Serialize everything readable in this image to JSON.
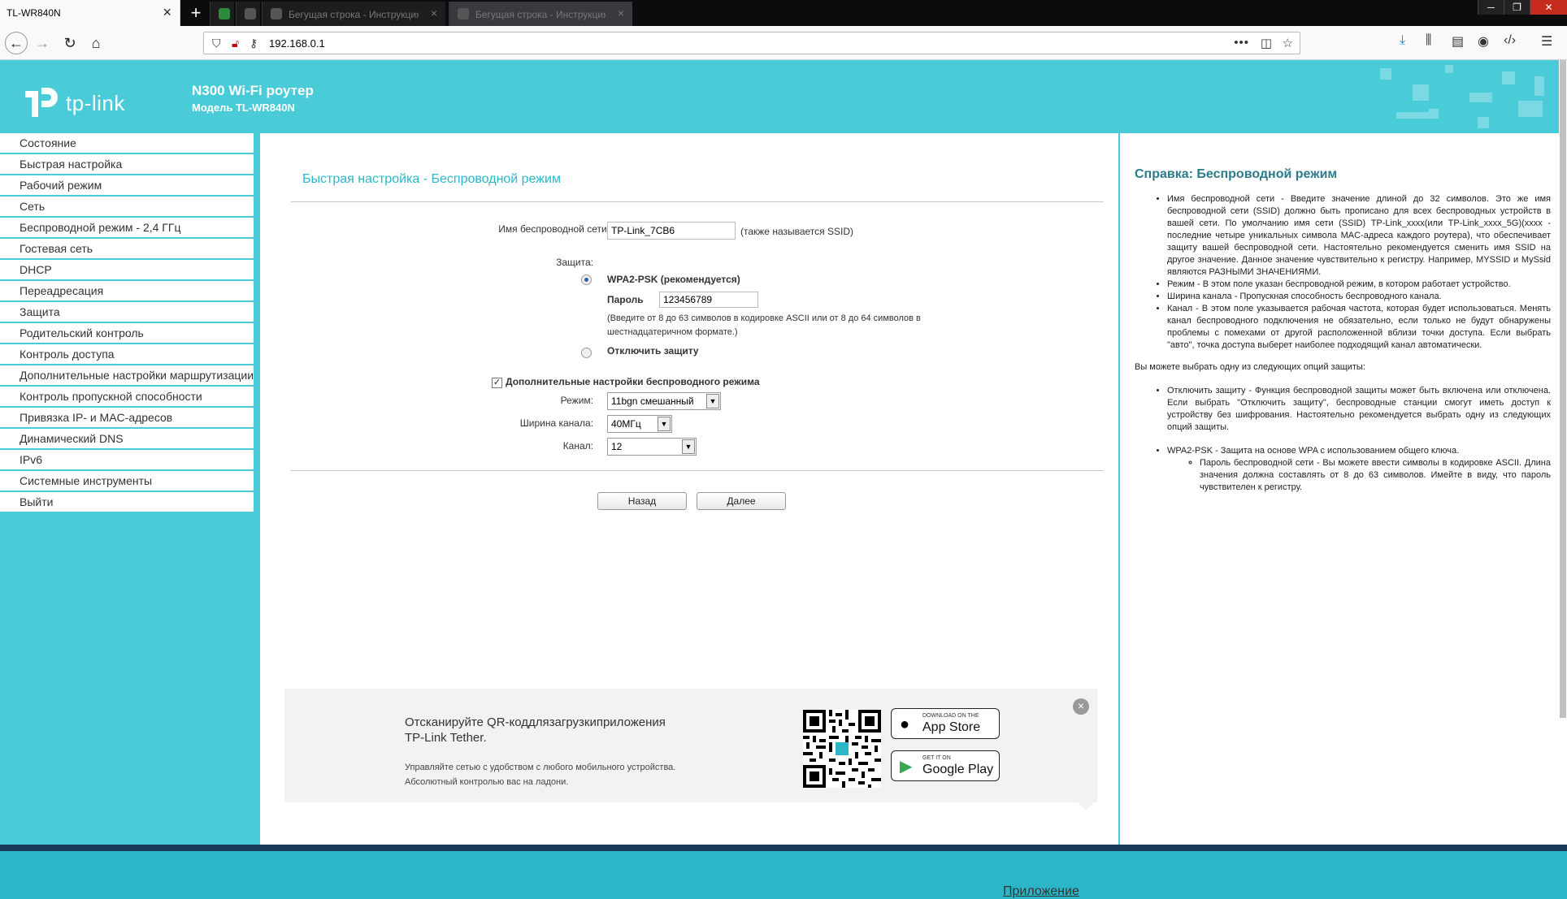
{
  "browser": {
    "active_tab_title": "TL-WR840N",
    "bg_tabs": [
      "Бегущая строка - Инструкция",
      "Бегущая строка - Инструкция"
    ],
    "url": "192.168.0.1"
  },
  "header": {
    "logo_text": "tp-link",
    "product_title": "N300 Wi-Fi роутер",
    "product_model": "Модель TL-WR840N"
  },
  "sidebar": {
    "items": [
      {
        "label": "Состояние"
      },
      {
        "label": "Быстрая настройка"
      },
      {
        "label": "Рабочий режим"
      },
      {
        "label": "Сеть"
      },
      {
        "label": "Беспроводной режим - 2,4 ГГц"
      },
      {
        "label": "Гостевая сеть"
      },
      {
        "label": "DHCP"
      },
      {
        "label": "Переадресация"
      },
      {
        "label": "Защита"
      },
      {
        "label": "Родительский контроль"
      },
      {
        "label": "Контроль доступа"
      },
      {
        "label": "Дополнительные настройки маршрутизации"
      },
      {
        "label": "Контроль пропускной способности"
      },
      {
        "label": "Привязка IP- и MAC-адресов"
      },
      {
        "label": "Динамический DNS"
      },
      {
        "label": "IPv6"
      },
      {
        "label": "Системные инструменты"
      },
      {
        "label": "Выйти"
      }
    ]
  },
  "form": {
    "page_title": "Быстрая настройка - Беспроводной режим",
    "ssid_label": "Имя беспроводной сети:",
    "ssid_value": "TP-Link_7CB6",
    "ssid_note": "(также называется SSID)",
    "security_label": "Защита:",
    "wpa2_label": "WPA2-PSK (рекомендуется)",
    "password_label": "Пароль",
    "password_value": "123456789",
    "password_hint_1": "(Введите от 8 до 63 символов в кодировке ASCII или от 8 до 64 символов в",
    "password_hint_2": "шестнадцатеричном формате.)",
    "disable_label": "Отключить защиту",
    "advanced_label": "Дополнительные настройки беспроводного режима",
    "mode_label": "Режим:",
    "mode_value": "11bgn смешанный",
    "width_label": "Ширина канала:",
    "width_value": "40МГц",
    "channel_label": "Канал:",
    "channel_value": "12",
    "back_button": "Назад",
    "next_button": "Далее"
  },
  "app_banner": {
    "title": "Отсканируйте QR-коддлязагрузкиприложения TP-Link Tether.",
    "desc_1": "Управляйте сетью с удобством с любого мобильного устройства.",
    "desc_2": "Абсолютный контролью вас на ладони.",
    "appstore_small": "DOWNLOAD ON THE",
    "appstore_big": "App Store",
    "gplay_small": "GET IT ON",
    "gplay_big": "Google Play",
    "link": "Приложение"
  },
  "help": {
    "title": "Справка: Беспроводной режим",
    "items_1": [
      "Имя беспроводной сети - Введите значение длиной до 32 символов. Это же имя беспроводной сети (SSID) должно быть прописано для всех беспроводных устройств в вашей сети. По умолчанию имя сети (SSID) TP-Link_xxxx(или TP-Link_xxxx_5G)(xxxx - последние четыре уникальных символа MAC-адреса каждого роутера), что обеспечивает защиту вашей беспроводной сети. Настоятельно рекомендуется сменить имя SSID на другое значение. Данное значение чувствительно к регистру. Например, MYSSID и MySsid являются РАЗНЫМИ ЗНАЧЕНИЯМИ.",
      "Режим - В этом поле указан беспроводной режим, в котором работает устройство.",
      "Ширина канала - Пропускная способность беспроводного канала.",
      "Канал - В этом поле указывается рабочая частота, которая будет использоваться. Менять канал беспроводного подключения не обязательно, если только не будут обнаружены проблемы с помехами от другой расположенной вблизи точки доступа. Если выбрать \"авто\", точка доступа выберет наиболее подходящий канал автоматически."
    ],
    "para": "Вы можете выбрать одну из следующих опций защиты:",
    "items_2": [
      "Отключить защиту - Функция беспроводной защиты может быть включена или отключена. Если выбрать \"Отключить защиту\", беспроводные станции смогут иметь доступ к устройству без шифрования. Настоятельно рекомендуется выбрать одну из следующих опций защиты."
    ],
    "items_3": [
      "WPA2-PSK - Защита на основе WPA с использованием общего ключа."
    ],
    "sub_items_3": [
      "Пароль беспроводной сети - Вы можете ввести символы в кодировке ASCII. Длина значения должна составлять от 8 до 63 символов. Имейте в виду, что пароль чувствителен к регистру."
    ]
  }
}
